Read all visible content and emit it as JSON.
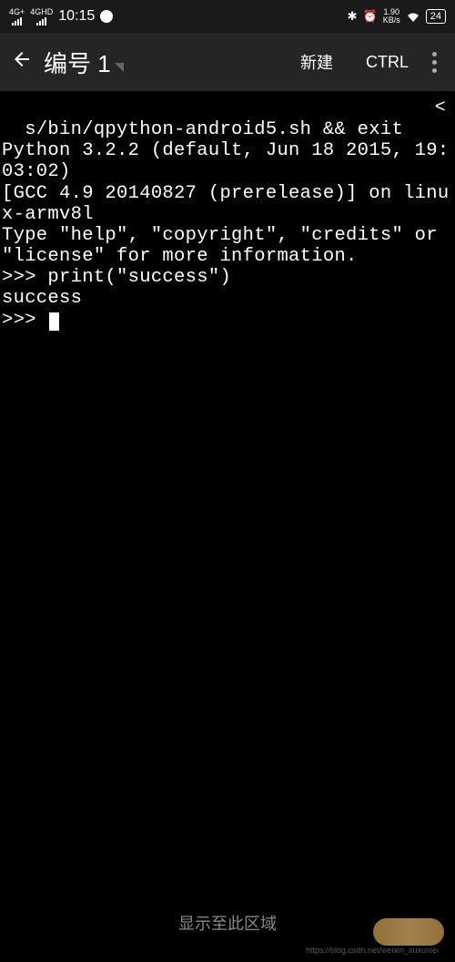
{
  "status_bar": {
    "network1": "4G+",
    "network2": "4GHD",
    "time": "10:15",
    "bluetooth_icon": "✱",
    "alarm_icon": "⏰",
    "speed_value": "1.90",
    "speed_unit": "KB/s",
    "wifi_icon": "◈",
    "battery": "24"
  },
  "app_bar": {
    "title": "编号 1",
    "action_new": "新建",
    "action_ctrl": "CTRL"
  },
  "terminal": {
    "line1": "s/bin/qpython-android5.sh && exit",
    "line2": "Python 3.2.2 (default, Jun 18 2015, 19:03:02)",
    "line3": "[GCC 4.9 20140827 (prerelease)] on linux-armv8l",
    "line4": "Type \"help\", \"copyright\", \"credits\" or \"license\" for more information.",
    "line5": ">>> print(\"success\")",
    "line6": "success",
    "line7": ">>> ",
    "back_char": "<"
  },
  "nav_label": "显示至此区域",
  "watermark": "https://blog.csdn.net/weixin_xuxunlei"
}
